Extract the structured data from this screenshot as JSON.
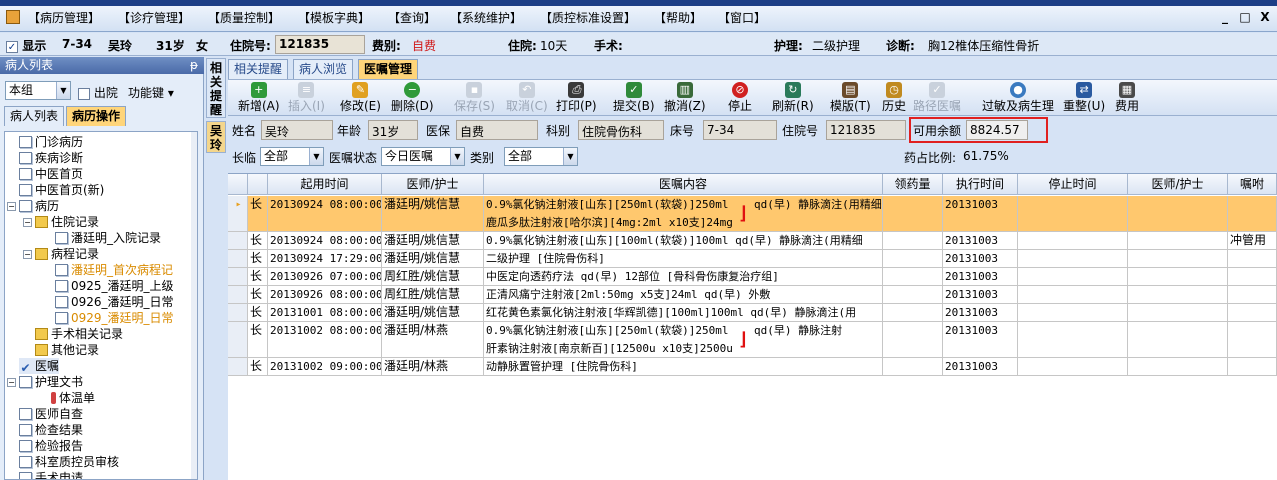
{
  "menu": {
    "items": [
      "【病历管理】",
      "【诊疗管理】",
      "【质量控制】",
      "【模板字典】",
      "【查询】",
      "【系统维护】",
      "【质控标准设置】",
      "【帮助】",
      "【窗口】"
    ],
    "window_buttons": [
      "_",
      "□",
      "X"
    ]
  },
  "patient_bar": {
    "display_label": "显示",
    "bed": "7-34",
    "name": "吴玲",
    "age": "31岁",
    "sex": "女",
    "admission_no_label": "住院号:",
    "admission_no": "121835",
    "fee_type_label": "费别:",
    "fee_type": "自费",
    "stay_label": "住院:",
    "stay": "10天",
    "surgery_label": "手术:",
    "care_label": "护理:",
    "care": "二级护理",
    "diagnosis_label": "诊断:",
    "diagnosis": "胸12椎体压缩性骨折"
  },
  "left_panel": {
    "title": "病人列表",
    "pin": "ᵽ",
    "group_select": "本组",
    "discharged_label": "出院",
    "function_key": "功能键",
    "tabs": [
      "病人列表",
      "病历操作"
    ]
  },
  "tree": {
    "nodes": [
      {
        "label": "门诊病历",
        "icon": "doc"
      },
      {
        "label": "疾病诊断",
        "icon": "doc"
      },
      {
        "label": "中医首页",
        "icon": "doc"
      },
      {
        "label": "中医首页(新)",
        "icon": "doc"
      },
      {
        "label": "病历",
        "icon": "doc"
      },
      {
        "label": "住院记录",
        "icon": "folder"
      },
      {
        "label": "潘廷明_入院记录",
        "icon": "doc"
      },
      {
        "label": "病程记录",
        "icon": "folder"
      },
      {
        "label": "潘廷明_首次病程记",
        "icon": "doc"
      },
      {
        "label": "0925_潘廷明_上级",
        "icon": "doc"
      },
      {
        "label": "0926_潘廷明_日常",
        "icon": "doc"
      },
      {
        "label": "0929_潘廷明_日常",
        "icon": "doc"
      },
      {
        "label": "手术相关记录",
        "icon": "folder"
      },
      {
        "label": "其他记录",
        "icon": "folder"
      },
      {
        "label": "医嘱",
        "icon": "check"
      },
      {
        "label": "护理文书",
        "icon": "doc"
      },
      {
        "label": "体温单",
        "icon": "thermo"
      },
      {
        "label": "医师自查",
        "icon": "doc"
      },
      {
        "label": "检查结果",
        "icon": "doc"
      },
      {
        "label": "检验报告",
        "icon": "doc"
      },
      {
        "label": "科室质控员审核",
        "icon": "doc"
      },
      {
        "label": "手术申请",
        "icon": "doc"
      }
    ]
  },
  "side_tabs": {
    "related": "相关提醒",
    "patient": "吴玲"
  },
  "main_tabs": [
    "相关提醒",
    "病人浏览",
    "医嘱管理"
  ],
  "toolbar": {
    "buttons": [
      {
        "label": "新增(A)",
        "icon": "plus-icon",
        "color": "#2f9a3a",
        "enabled": true
      },
      {
        "label": "插入(I)",
        "icon": "insert-icon",
        "color": "#8a8a8a",
        "enabled": false
      },
      {
        "label": "修改(E)",
        "icon": "edit-icon",
        "color": "#e0a020",
        "enabled": true
      },
      {
        "label": "删除(D)",
        "icon": "minus-icon",
        "color": "#2f9a3a",
        "enabled": true
      },
      {
        "label": "保存(S)",
        "icon": "save-icon",
        "color": "#8a8a8a",
        "enabled": false
      },
      {
        "label": "取消(C)",
        "icon": "undo-icon",
        "color": "#8a8a8a",
        "enabled": false
      },
      {
        "label": "打印(P)",
        "icon": "print-icon",
        "color": "#3a3a3a",
        "enabled": true
      },
      {
        "label": "提交(B)",
        "icon": "submit-icon",
        "color": "#2f8a3a",
        "enabled": true
      },
      {
        "label": "撤消(Z)",
        "icon": "trash-icon",
        "color": "#3a6a3a",
        "enabled": true
      },
      {
        "label": "停止",
        "icon": "stop-icon",
        "color": "#d02020",
        "enabled": true
      },
      {
        "label": "刷新(R)",
        "icon": "refresh-icon",
        "color": "#2a7a5a",
        "enabled": true
      },
      {
        "label": "模版(T)",
        "icon": "template-icon",
        "color": "#6a4a2a",
        "enabled": true
      },
      {
        "label": "历史",
        "icon": "history-icon",
        "color": "#c08a20",
        "enabled": true
      },
      {
        "label": "路径医嘱",
        "icon": "path-icon",
        "color": "#8a8a8a",
        "enabled": false
      },
      {
        "label": "过敏及病生理",
        "icon": "allergy-icon",
        "color": "#3a7ac0",
        "enabled": true
      },
      {
        "label": "重整(U)",
        "icon": "reorganize-icon",
        "color": "#2a5aa0",
        "enabled": true
      },
      {
        "label": "费用",
        "icon": "fee-icon",
        "color": "#4a4a4a",
        "enabled": true
      }
    ]
  },
  "info": {
    "name_label": "姓名",
    "name": "吴玲",
    "age_label": "年龄",
    "age": "31岁",
    "insurance_label": "医保",
    "insurance": "自费",
    "dept_label": "科别",
    "dept": "住院骨伤科",
    "bed_label": "床号",
    "bed": "7-34",
    "admission_label": "住院号",
    "admission": "121835",
    "balance_label": "可用余额",
    "balance": "8824.57"
  },
  "filters": {
    "long_temp_label": "长临",
    "long_temp": "全部",
    "status_label": "医嘱状态",
    "status": "今日医嘱",
    "category_label": "类别",
    "category": "全部",
    "drug_ratio_label": "药占比例:",
    "drug_ratio": "61.75%"
  },
  "grid": {
    "columns": [
      "",
      "",
      "起用时间",
      "医师/护士",
      "医嘱内容",
      "领药量",
      "执行时间",
      "停止时间",
      "医师/护士",
      "嘱咐"
    ],
    "rows": [
      {
        "type": "长",
        "start": "20130924 08:00:00",
        "doctor": "潘廷明/姚信慧",
        "content": [
          "0.9%氯化钠注射液[山东][250ml(软袋)]250ml",
          "鹿瓜多肽注射液[哈尔滨][4mg:2ml x10支]24mg"
        ],
        "usage": "qd(早) 静脉滴注(用精细",
        "exec": "20131003",
        "note": "",
        "selected": true
      },
      {
        "type": "长",
        "start": "20130924 08:00:00",
        "doctor": "潘廷明/姚信慧",
        "content": [
          "0.9%氯化钠注射液[山东][100ml(软袋)]100ml   qd(早) 静脉滴注(用精细"
        ],
        "usage": "",
        "exec": "20131003",
        "note": "冲管用",
        "selected": false
      },
      {
        "type": "长",
        "start": "20130924 17:29:00",
        "doctor": "潘廷明/姚信慧",
        "content": [
          "二级护理   [住院骨伤科]"
        ],
        "usage": "",
        "exec": "20131003",
        "note": "",
        "selected": false
      },
      {
        "type": "长",
        "start": "20130926 07:00:00",
        "doctor": "周红胜/姚信慧",
        "content": [
          "中医定向透药疗法 qd(早) 12部位 [骨科骨伤康复治疗组]"
        ],
        "usage": "",
        "exec": "20131003",
        "note": "",
        "selected": false
      },
      {
        "type": "长",
        "start": "20130926 08:00:00",
        "doctor": "周红胜/姚信慧",
        "content": [
          "正清风痛宁注射液[2ml:50mg x5支]24ml   qd(早) 外敷"
        ],
        "usage": "",
        "exec": "20131003",
        "note": "",
        "selected": false
      },
      {
        "type": "长",
        "start": "20131001 08:00:00",
        "doctor": "潘廷明/姚信慧",
        "content": [
          "红花黄色素氯化钠注射液[华辉凯德][100ml]100ml   qd(早) 静脉滴注(用"
        ],
        "usage": "",
        "exec": "20131003",
        "note": "",
        "selected": false
      },
      {
        "type": "长",
        "start": "20131002 08:00:00",
        "doctor": "潘廷明/林燕",
        "content": [
          "0.9%氯化钠注射液[山东][250ml(软袋)]250ml",
          "肝素钠注射液[南京新百][12500u x10支]2500u"
        ],
        "usage": "qd(早) 静脉注射",
        "exec": "20131003",
        "note": "",
        "selected": false
      },
      {
        "type": "长",
        "start": "20131002 09:00:00",
        "doctor": "潘廷明/林燕",
        "content": [
          "动静脉置管护理   [住院骨伤科]"
        ],
        "usage": "",
        "exec": "20131003",
        "note": "",
        "selected": false
      }
    ]
  }
}
